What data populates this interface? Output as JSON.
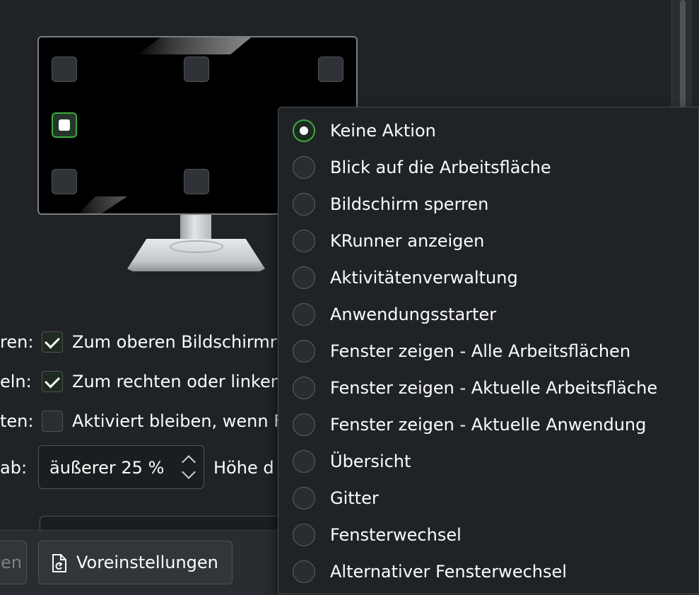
{
  "rows": {
    "row1": {
      "label_tail": "ren:",
      "checked": true,
      "text": "Zum oberen Bildschirmr"
    },
    "row2": {
      "label_tail": "eln:",
      "checked": true,
      "text": "Zum rechten oder linken"
    },
    "row3": {
      "label_tail": "ten:",
      "checked": false,
      "text": "Aktiviert bleiben, wenn F"
    },
    "row4": {
      "label_tail": "ab:",
      "spin_value": "äußerer 25 %",
      "suffix": "Höhe d"
    }
  },
  "buttons": {
    "hidden_label": "en",
    "defaults_label": "Voreinstellungen",
    "defaults_icon": "document-revert-icon"
  },
  "menu": {
    "items": [
      {
        "label": "Keine Aktion",
        "selected": true
      },
      {
        "label": "Blick auf die Arbeitsfläche",
        "selected": false
      },
      {
        "label": "Bildschirm sperren",
        "selected": false
      },
      {
        "label": "KRunner anzeigen",
        "selected": false
      },
      {
        "label": "Aktivitätenverwaltung",
        "selected": false
      },
      {
        "label": "Anwendungsstarter",
        "selected": false
      },
      {
        "label": "Fenster zeigen - Alle Arbeitsflächen",
        "selected": false
      },
      {
        "label": "Fenster zeigen - Aktuelle Arbeitsfläche",
        "selected": false
      },
      {
        "label": "Fenster zeigen - Aktuelle Anwendung",
        "selected": false
      },
      {
        "label": "Übersicht",
        "selected": false
      },
      {
        "label": "Gitter",
        "selected": false
      },
      {
        "label": "Fensterwechsel",
        "selected": false
      },
      {
        "label": "Alternativer Fensterwechsel",
        "selected": false
      }
    ]
  },
  "colors": {
    "accent": "#3daa3d",
    "background": "#202326",
    "text": "#fcfcfc"
  }
}
